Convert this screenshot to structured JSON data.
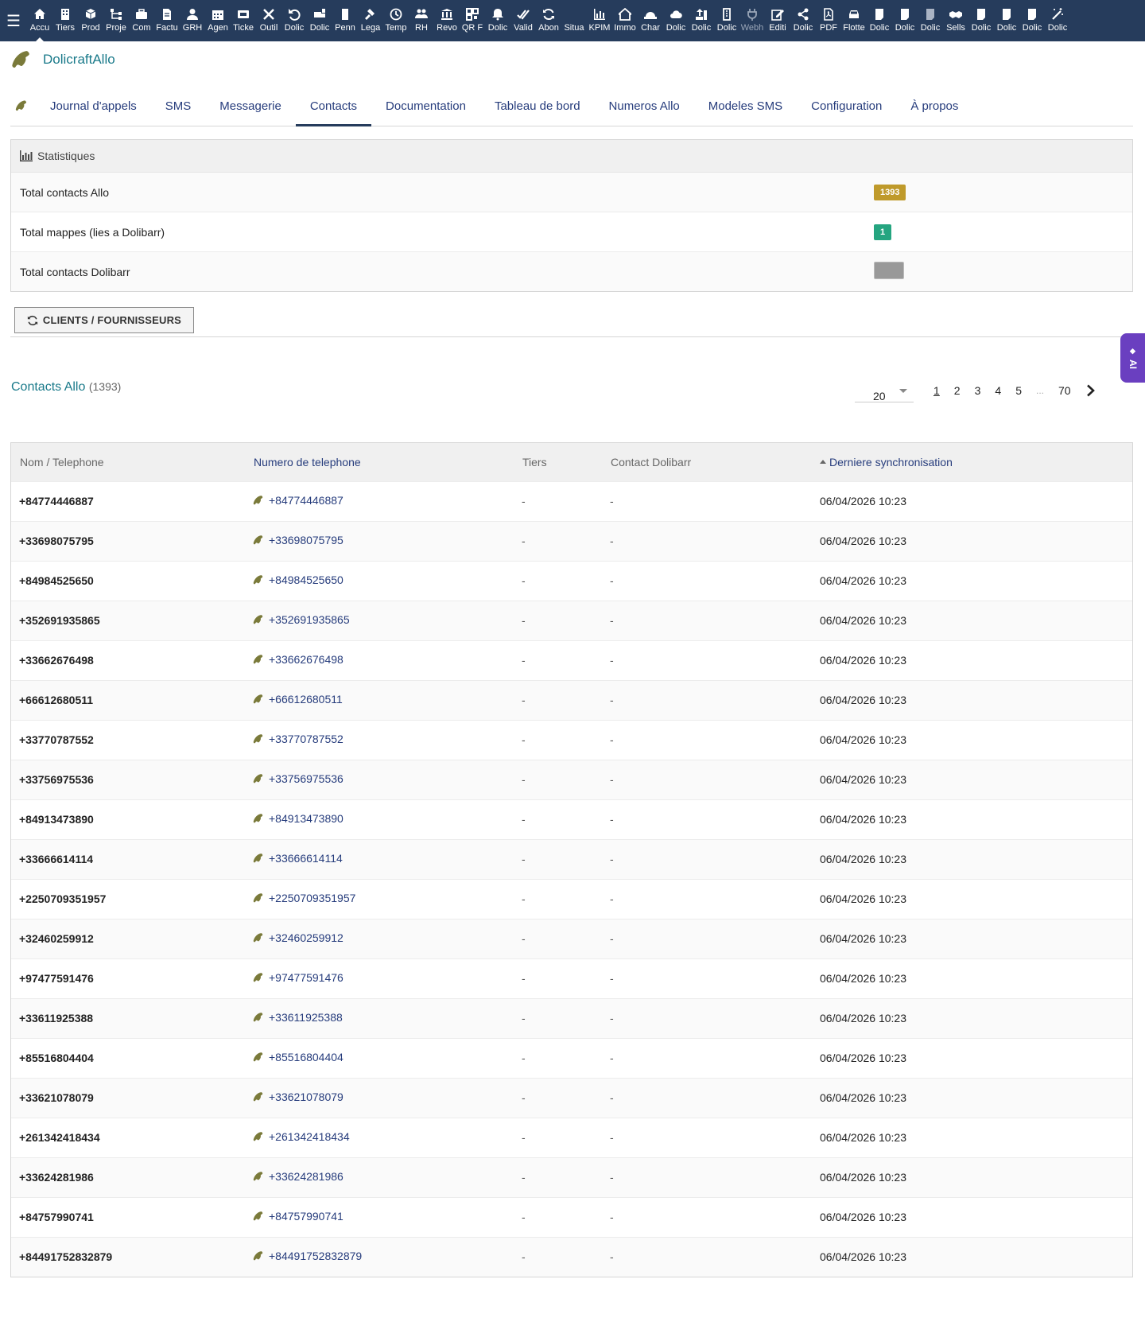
{
  "topbar": {
    "items": [
      {
        "label": "Accu",
        "icon": "home-icon",
        "active": true
      },
      {
        "label": "Tiers",
        "icon": "building-icon"
      },
      {
        "label": "Prod",
        "icon": "cube-icon"
      },
      {
        "label": "Proje",
        "icon": "sitemap-icon"
      },
      {
        "label": "Com",
        "icon": "suitcase-icon"
      },
      {
        "label": "Factu",
        "icon": "invoice-icon"
      },
      {
        "label": "GRH",
        "icon": "user-tie-icon"
      },
      {
        "label": "Agen",
        "icon": "calendar-icon"
      },
      {
        "label": "Ticke",
        "icon": "ticket-icon"
      },
      {
        "label": "Outil",
        "icon": "tools-icon"
      },
      {
        "label": "Dolic",
        "icon": "undo-icon"
      },
      {
        "label": "Dolic",
        "icon": "truck-icon"
      },
      {
        "label": "Penn",
        "icon": "file-icon"
      },
      {
        "label": "Lega",
        "icon": "gavel-icon"
      },
      {
        "label": "Temp",
        "icon": "clock-icon"
      },
      {
        "label": "RH",
        "icon": "users-icon"
      },
      {
        "label": "Revo",
        "icon": "bank-icon"
      },
      {
        "label": "QR F",
        "icon": "qrcode-icon"
      },
      {
        "label": "Dolic",
        "icon": "bell-icon"
      },
      {
        "label": "Valid",
        "icon": "check-double-icon"
      },
      {
        "label": "Abon",
        "icon": "sync-icon"
      },
      {
        "label": "Situa",
        "icon": "blank-icon"
      },
      {
        "label": "KPIM",
        "icon": "chart-bar-icon"
      },
      {
        "label": "Immo",
        "icon": "house-icon"
      },
      {
        "label": "Char",
        "icon": "hard-hat-icon"
      },
      {
        "label": "Dolic",
        "icon": "cloud-icon"
      },
      {
        "label": "Dolic",
        "icon": "upload-icon"
      },
      {
        "label": "Dolic",
        "icon": "tower-icon"
      },
      {
        "label": "Webh",
        "icon": "plug-icon",
        "dim": true
      },
      {
        "label": "Editi",
        "icon": "edit-icon"
      },
      {
        "label": "Dolic",
        "icon": "share-icon"
      },
      {
        "label": "PDF",
        "icon": "pdf-icon"
      },
      {
        "label": "Flotte",
        "icon": "car-icon"
      },
      {
        "label": "Dolic",
        "icon": "doc-icon"
      },
      {
        "label": "Dolic",
        "icon": "doc-icon"
      },
      {
        "label": "Dolic",
        "icon": "doc-dim-icon"
      },
      {
        "label": "Sells",
        "icon": "handshake-icon"
      },
      {
        "label": "Dolic",
        "icon": "doc-icon"
      },
      {
        "label": "Dolic",
        "icon": "doc-icon"
      },
      {
        "label": "Dolic",
        "icon": "doc-icon"
      },
      {
        "label": "Dolic",
        "icon": "magic-icon"
      }
    ]
  },
  "module": {
    "title": "DolicraftAllo"
  },
  "tabs": [
    {
      "label": "Journal d'appels"
    },
    {
      "label": "SMS"
    },
    {
      "label": "Messagerie"
    },
    {
      "label": "Contacts",
      "active": true
    },
    {
      "label": "Documentation"
    },
    {
      "label": "Tableau de bord"
    },
    {
      "label": "Numeros Allo"
    },
    {
      "label": "Modeles SMS"
    },
    {
      "label": "Configuration"
    },
    {
      "label": "À propos"
    }
  ],
  "stats": {
    "title": "Statistiques",
    "rows": [
      {
        "label": "Total contacts Allo",
        "value": "1393",
        "color": "#bf9a2b"
      },
      {
        "label": "Total mappes (lies a Dolibarr)",
        "value": "1",
        "color": "#25a580"
      },
      {
        "label": "Total contacts Dolibarr",
        "value": "",
        "color": "#999999"
      }
    ]
  },
  "sync_button": {
    "label": "CLIENTS / FOURNISSEURS"
  },
  "ai_tab": {
    "label": "AI"
  },
  "list": {
    "title": "Contacts Allo",
    "count": "(1393)",
    "limit": "20",
    "pages": [
      "1",
      "2",
      "3",
      "4",
      "5"
    ],
    "dots": "...",
    "last_page": "70",
    "columns": {
      "name": "Nom / Telephone",
      "phone": "Numero de telephone",
      "tiers": "Tiers",
      "contact": "Contact Dolibarr",
      "sync": "Derniere synchronisation"
    },
    "rows": [
      {
        "name": "+84774446887",
        "phone": "+84774446887",
        "tiers": "-",
        "contact": "-",
        "sync": "06/04/2026 10:23"
      },
      {
        "name": "+33698075795",
        "phone": "+33698075795",
        "tiers": "-",
        "contact": "-",
        "sync": "06/04/2026 10:23"
      },
      {
        "name": "+84984525650",
        "phone": "+84984525650",
        "tiers": "-",
        "contact": "-",
        "sync": "06/04/2026 10:23"
      },
      {
        "name": "+352691935865",
        "phone": "+352691935865",
        "tiers": "-",
        "contact": "-",
        "sync": "06/04/2026 10:23"
      },
      {
        "name": "+33662676498",
        "phone": "+33662676498",
        "tiers": "-",
        "contact": "-",
        "sync": "06/04/2026 10:23"
      },
      {
        "name": "+66612680511",
        "phone": "+66612680511",
        "tiers": "-",
        "contact": "-",
        "sync": "06/04/2026 10:23"
      },
      {
        "name": "+33770787552",
        "phone": "+33770787552",
        "tiers": "-",
        "contact": "-",
        "sync": "06/04/2026 10:23"
      },
      {
        "name": "+33756975536",
        "phone": "+33756975536",
        "tiers": "-",
        "contact": "-",
        "sync": "06/04/2026 10:23"
      },
      {
        "name": "+84913473890",
        "phone": "+84913473890",
        "tiers": "-",
        "contact": "-",
        "sync": "06/04/2026 10:23"
      },
      {
        "name": "+33666614114",
        "phone": "+33666614114",
        "tiers": "-",
        "contact": "-",
        "sync": "06/04/2026 10:23"
      },
      {
        "name": "+2250709351957",
        "phone": "+2250709351957",
        "tiers": "-",
        "contact": "-",
        "sync": "06/04/2026 10:23"
      },
      {
        "name": "+32460259912",
        "phone": "+32460259912",
        "tiers": "-",
        "contact": "-",
        "sync": "06/04/2026 10:23"
      },
      {
        "name": "+97477591476",
        "phone": "+97477591476",
        "tiers": "-",
        "contact": "-",
        "sync": "06/04/2026 10:23"
      },
      {
        "name": "+33611925388",
        "phone": "+33611925388",
        "tiers": "-",
        "contact": "-",
        "sync": "06/04/2026 10:23"
      },
      {
        "name": "+85516804404",
        "phone": "+85516804404",
        "tiers": "-",
        "contact": "-",
        "sync": "06/04/2026 10:23"
      },
      {
        "name": "+33621078079",
        "phone": "+33621078079",
        "tiers": "-",
        "contact": "-",
        "sync": "06/04/2026 10:23"
      },
      {
        "name": "+261342418434",
        "phone": "+261342418434",
        "tiers": "-",
        "contact": "-",
        "sync": "06/04/2026 10:23"
      },
      {
        "name": "+33624281986",
        "phone": "+33624281986",
        "tiers": "-",
        "contact": "-",
        "sync": "06/04/2026 10:23"
      },
      {
        "name": "+84757990741",
        "phone": "+84757990741",
        "tiers": "-",
        "contact": "-",
        "sync": "06/04/2026 10:23"
      },
      {
        "name": "+84491752832879",
        "phone": "+84491752832879",
        "tiers": "-",
        "contact": "-",
        "sync": "06/04/2026 10:23"
      }
    ]
  }
}
